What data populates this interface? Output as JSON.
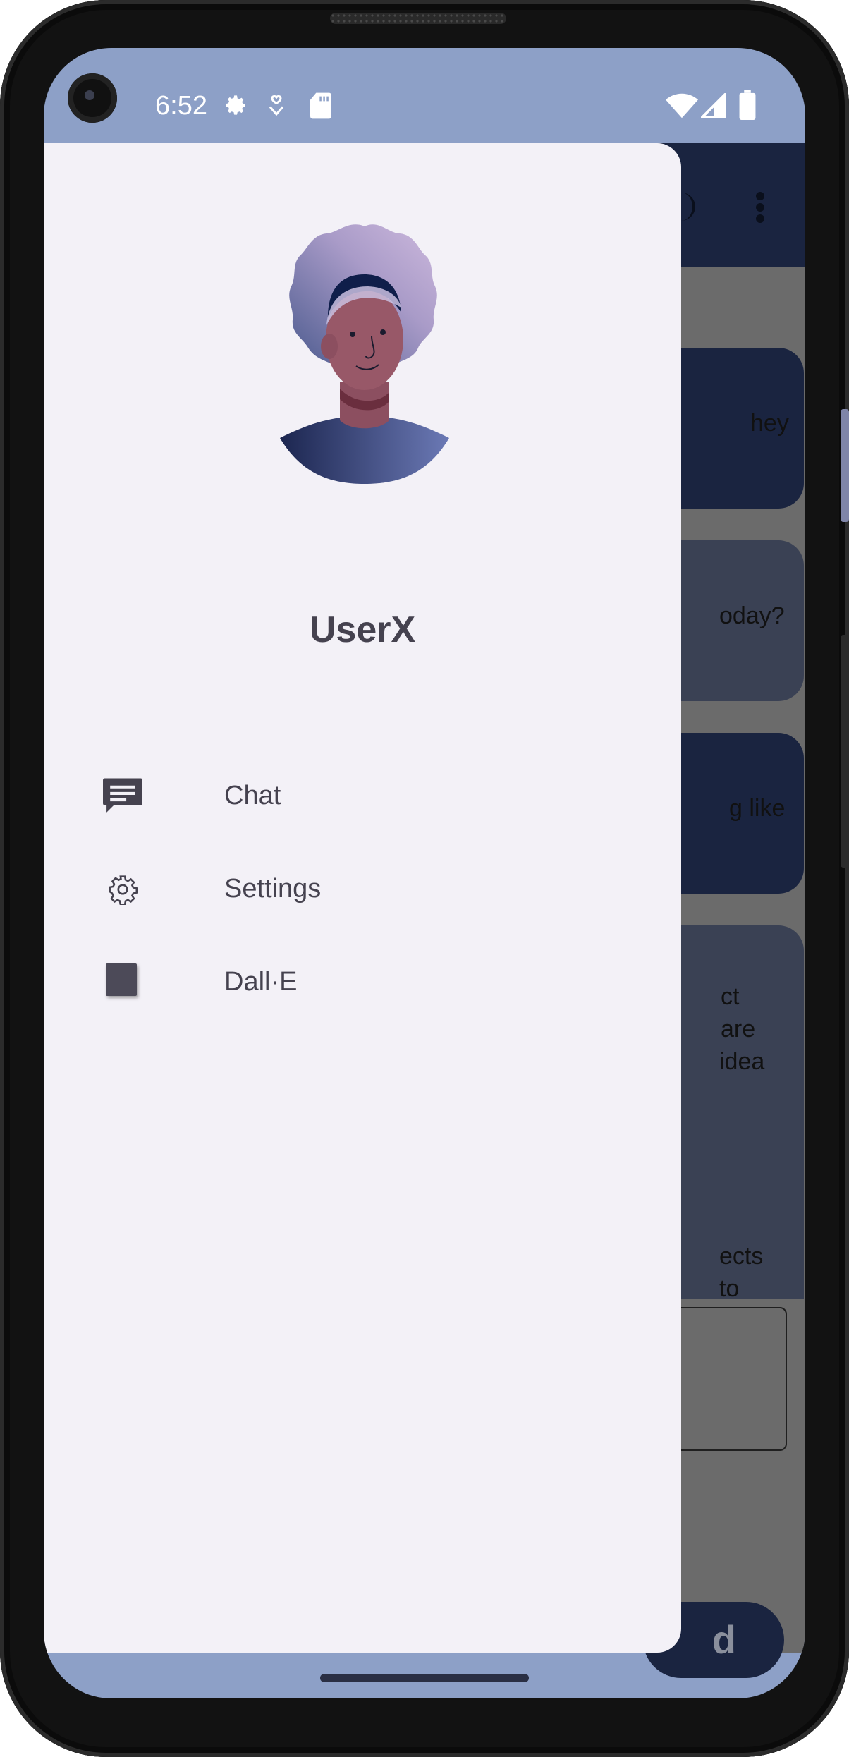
{
  "status_bar": {
    "time": "6:52",
    "left_icons": [
      "settings-gear-icon",
      "hand-heart-icon",
      "sd-card-icon"
    ],
    "right_icons": [
      "wifi-icon",
      "cell-signal-icon",
      "battery-icon"
    ]
  },
  "drawer": {
    "username": "UserX",
    "items": [
      {
        "label": "Chat",
        "icon": "chat-icon"
      },
      {
        "label": "Settings",
        "icon": "settings-icon"
      },
      {
        "label": "Dall·E",
        "icon": "square-icon"
      }
    ]
  },
  "background_app": {
    "messages": [
      {
        "visible_text": "hey",
        "style": "dark"
      },
      {
        "visible_text": "oday?",
        "style": "grey"
      },
      {
        "visible_text": "g like",
        "style": "dark"
      },
      {
        "visible_text": [
          "ct",
          "are",
          "idea",
          "ects",
          "to"
        ],
        "style": "grey"
      }
    ],
    "send_button_visible_text": "d"
  },
  "colors": {
    "status_bar": "#8da0c7",
    "drawer_bg": "#f3f1f7",
    "app_bar": "#1a2440",
    "scrim": "#6b6b6b",
    "text": "#45424f"
  }
}
